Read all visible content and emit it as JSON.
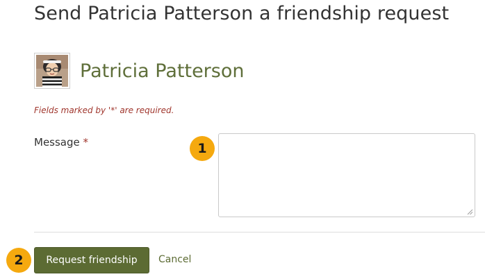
{
  "page": {
    "title": "Send Patricia Patterson a friendship request"
  },
  "profile": {
    "name": "Patricia Patterson",
    "avatar_icon": "user-avatar-icon"
  },
  "form": {
    "required_note": "Fields marked by '*' are required.",
    "message_label": "Message",
    "required_marker": "*",
    "message_value": "",
    "submit_label": "Request friendship",
    "cancel_label": "Cancel"
  },
  "callouts": {
    "first": "1",
    "second": "2"
  },
  "colors": {
    "accent": "#5c6b33",
    "name_text": "#5f6f3a",
    "required": "#a0362d",
    "callout_badge": "#f5a90f"
  }
}
